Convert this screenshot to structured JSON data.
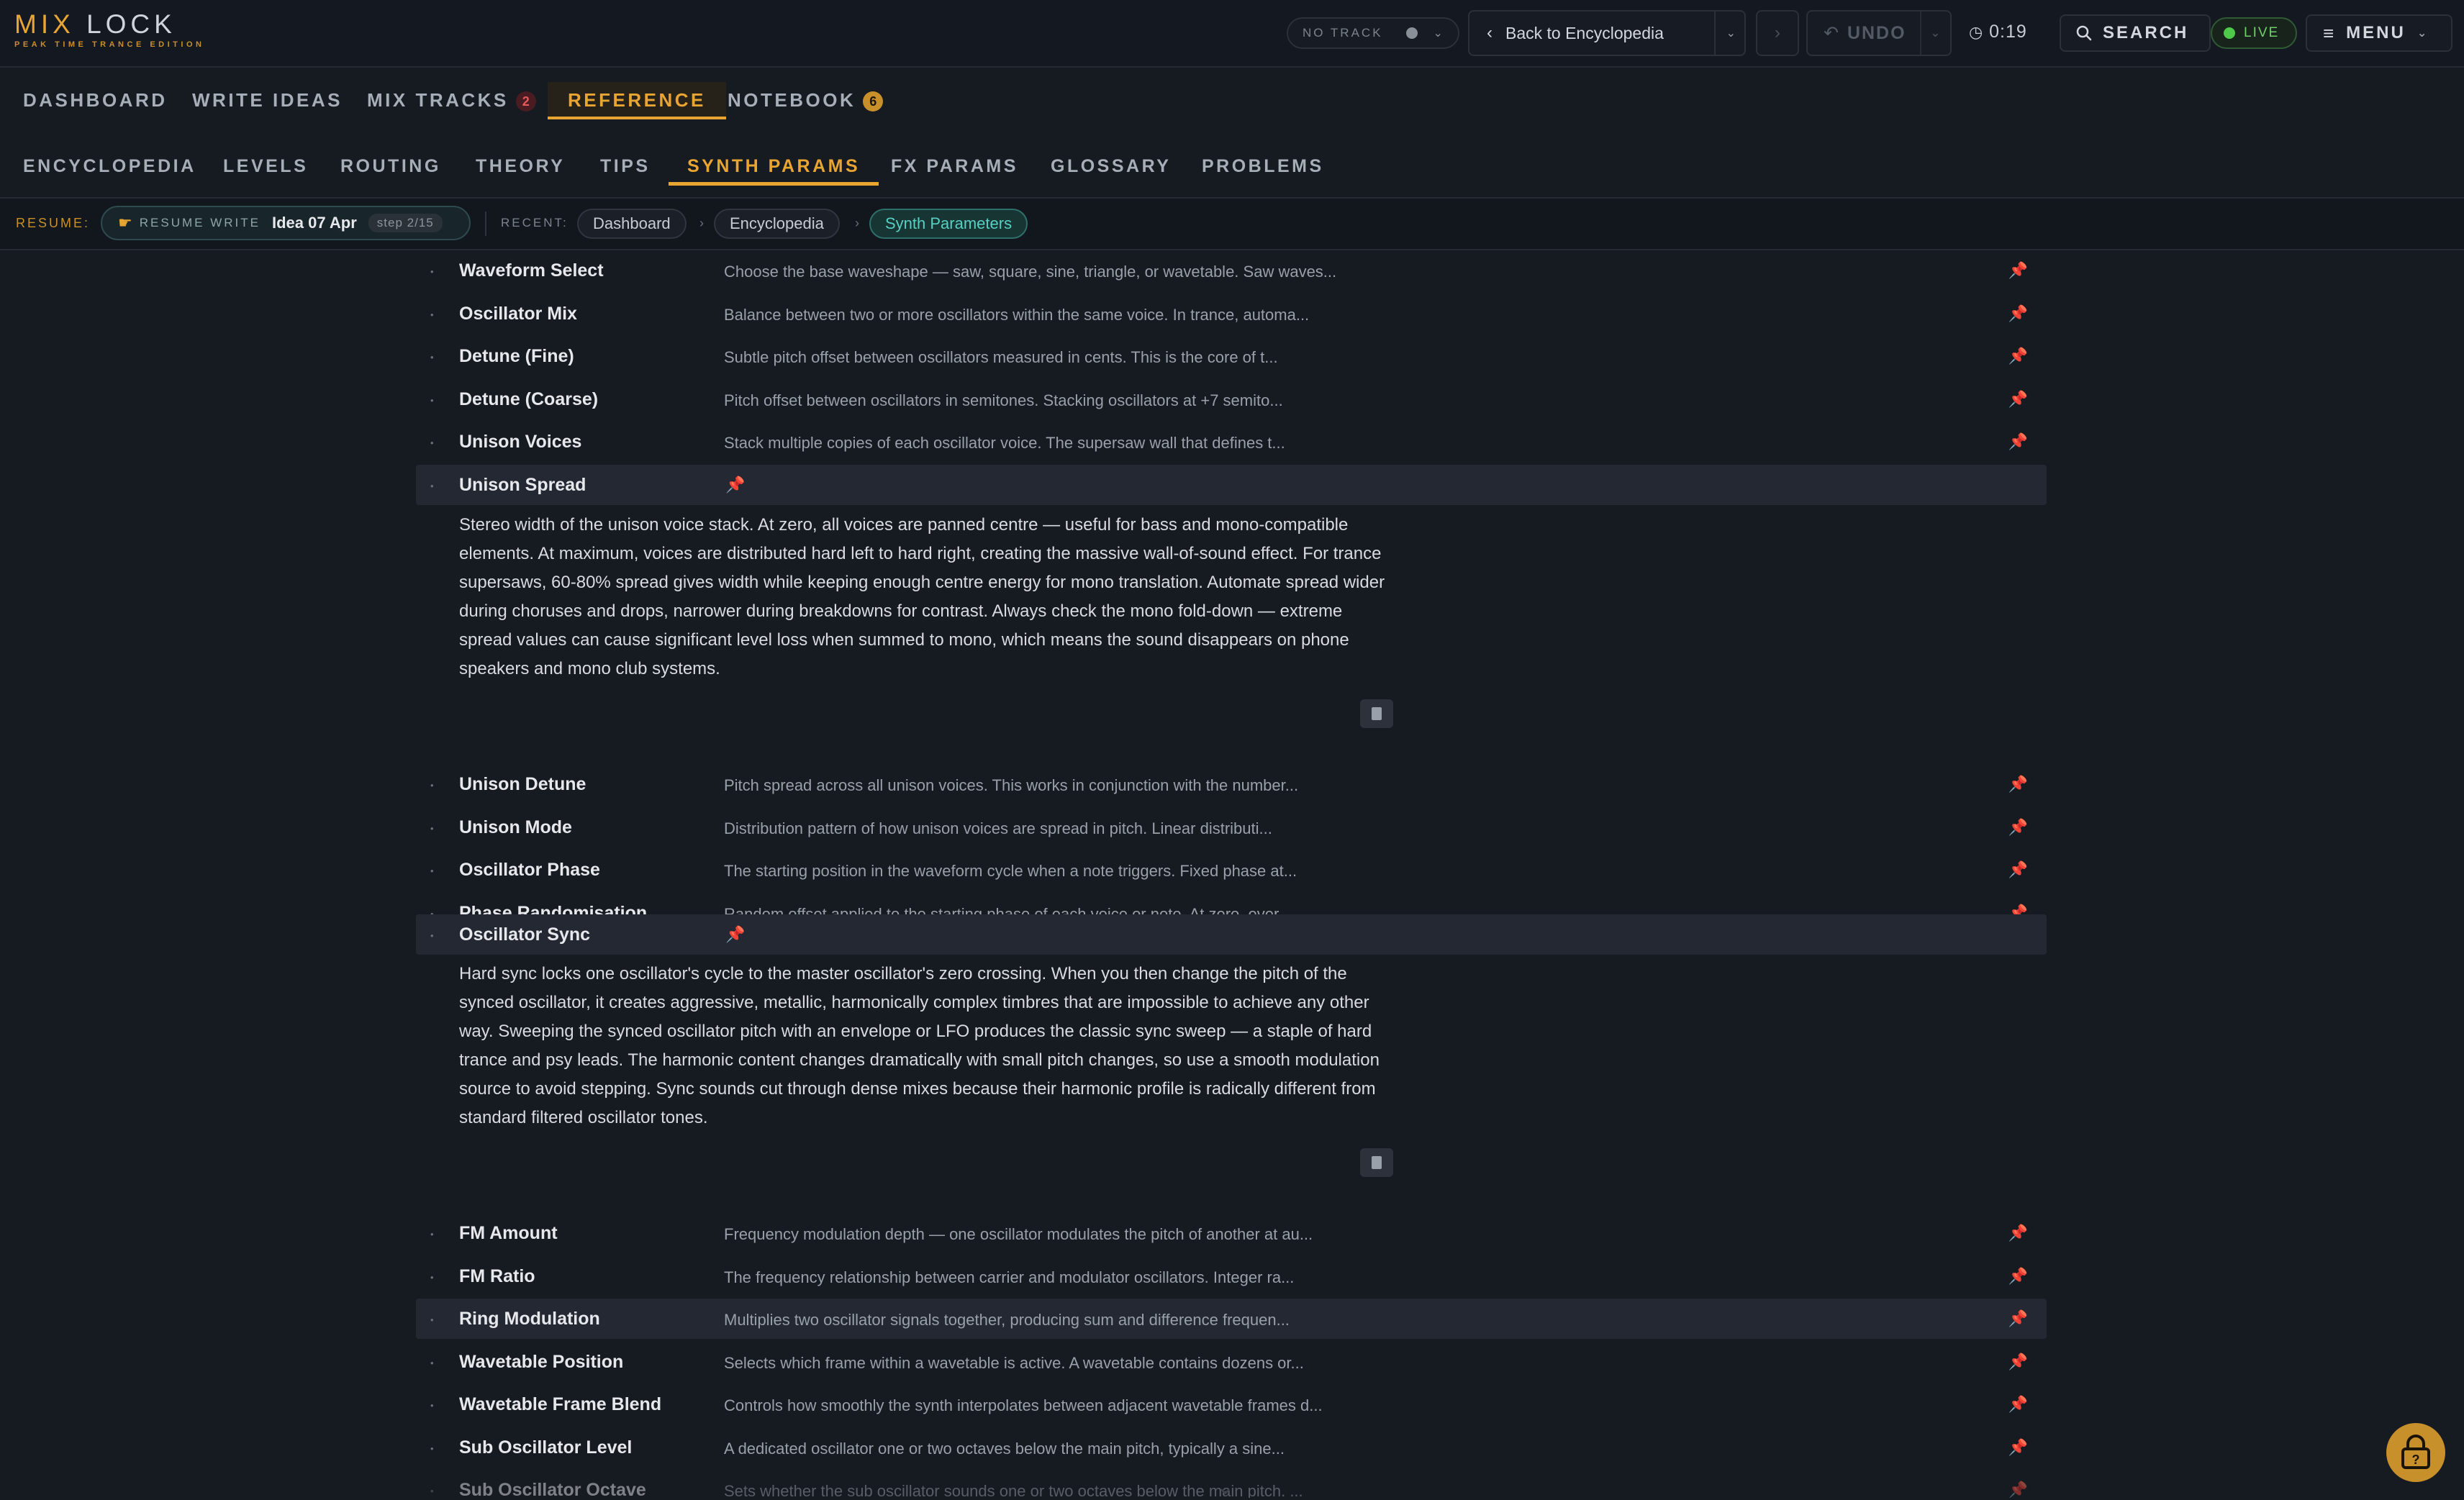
{
  "app": {
    "title_part1": "MIX ",
    "title_part2": "LOCK",
    "subtitle": "PEAK TIME TRANCE EDITION"
  },
  "topbar": {
    "no_track": "NO TRACK",
    "back_label": "Back to Encyclopedia",
    "undo_label": "UNDO",
    "timer": "0:19",
    "search_label": "SEARCH",
    "live_label": "LIVE",
    "menu_label": "MENU"
  },
  "nav_primary": [
    {
      "label": "DASHBOARD"
    },
    {
      "label": "WRITE IDEAS"
    },
    {
      "label": "MIX TRACKS",
      "badge": "2"
    },
    {
      "label": "REFERENCE",
      "active": true
    },
    {
      "label": "NOTEBOOK",
      "badge": "6"
    }
  ],
  "nav_secondary": [
    {
      "label": "ENCYCLOPEDIA"
    },
    {
      "label": "LEVELS"
    },
    {
      "label": "ROUTING"
    },
    {
      "label": "THEORY"
    },
    {
      "label": "TIPS"
    },
    {
      "label": "SYNTH PARAMS",
      "active": true
    },
    {
      "label": "FX PARAMS"
    },
    {
      "label": "GLOSSARY"
    },
    {
      "label": "PROBLEMS"
    }
  ],
  "resume_bar": {
    "resume_label": "RESUME:",
    "resume_tag": "RESUME WRITE",
    "idea": "Idea 07 Apr",
    "step": "step 2/15",
    "recent_label": "RECENT:",
    "recent": [
      "Dashboard",
      "Encyclopedia",
      "Synth Parameters"
    ],
    "separator": "›"
  },
  "params": [
    {
      "name": "Waveform Select",
      "desc": "Choose the base waveshape — saw, square, sine, triangle, or wavetable. Saw waves..."
    },
    {
      "name": "Oscillator Mix",
      "desc": "Balance between two or more oscillators within the same voice. In trance, automa..."
    },
    {
      "name": "Detune (Fine)",
      "desc": "Subtle pitch offset between oscillators measured in cents. This is the core of t..."
    },
    {
      "name": "Detune (Coarse)",
      "desc": "Pitch offset between oscillators in semitones. Stacking oscillators at +7 semito..."
    },
    {
      "name": "Unison Voices",
      "desc": "Stack multiple copies of each oscillator voice. The supersaw wall that defines t..."
    },
    {
      "name": "Unison Spread",
      "expanded": true,
      "full": "Stereo width of the unison voice stack. At zero, all voices are panned centre — useful for bass and mono-compatible elements. At maximum, voices are distributed hard left to hard right, creating the massive wall-of-sound effect. For trance supersaws, 60-80% spread gives width while keeping enough centre energy for mono translation. Automate spread wider during choruses and drops, narrower during breakdowns for contrast. Always check the mono fold-down — extreme spread values can cause significant level loss when summed to mono, which means the sound disappears on phone speakers and mono club systems."
    },
    {
      "name": "Unison Detune",
      "desc": "Pitch spread across all unison voices. This works in conjunction with the number..."
    },
    {
      "name": "Unison Mode",
      "desc": "Distribution pattern of how unison voices are spread in pitch. Linear distributi..."
    },
    {
      "name": "Oscillator Phase",
      "desc": "The starting position in the waveform cycle when a note triggers. Fixed phase at..."
    },
    {
      "name": "Phase Randomisation",
      "desc": "Random offset applied to the starting phase of each voice or note. At zero, ever..."
    },
    {
      "name": "Oscillator Sync",
      "expanded": true,
      "full": "Hard sync locks one oscillator's cycle to the master oscillator's zero crossing. When you then change the pitch of the synced oscillator, it creates aggressive, metallic, harmonically complex timbres that are impossible to achieve any other way. Sweeping the synced oscillator pitch with an envelope or LFO produces the classic sync sweep — a staple of hard trance and psy leads. The harmonic content changes dramatically with small pitch changes, so use a smooth modulation source to avoid stepping. Sync sounds cut through dense mixes because their harmonic profile is radically different from standard filtered oscillator tones."
    },
    {
      "name": "FM Amount",
      "desc": "Frequency modulation depth — one oscillator modulates the pitch of another at au..."
    },
    {
      "name": "FM Ratio",
      "desc": "The frequency relationship between carrier and modulator oscillators. Integer ra..."
    },
    {
      "name": "Ring Modulation",
      "desc": "Multiplies two oscillator signals together, producing sum and difference frequen...",
      "hover": true
    },
    {
      "name": "Wavetable Position",
      "desc": "Selects which frame within a wavetable is active. A wavetable contains dozens or..."
    },
    {
      "name": "Wavetable Frame Blend",
      "desc": "Controls how smoothly the synth interpolates between adjacent wavetable frames d..."
    },
    {
      "name": "Sub Oscillator Level",
      "desc": "A dedicated oscillator one or two octaves below the main pitch, typically a sine..."
    },
    {
      "name": "Sub Oscillator Octave",
      "desc": "Sets whether the sub oscillator sounds one or two octaves below the main pitch. ...",
      "faded": true
    }
  ],
  "colors": {
    "accent": "#e8a531",
    "background": "#161a21",
    "pin": "#b5444b",
    "live": "#4fc94a",
    "teal": "#57d0c3"
  },
  "icons": [
    "pin-icon",
    "search-icon",
    "clock-icon",
    "undo-icon",
    "hamburger-icon",
    "chevron-down-icon",
    "lock-help-icon",
    "copy-icon"
  ]
}
